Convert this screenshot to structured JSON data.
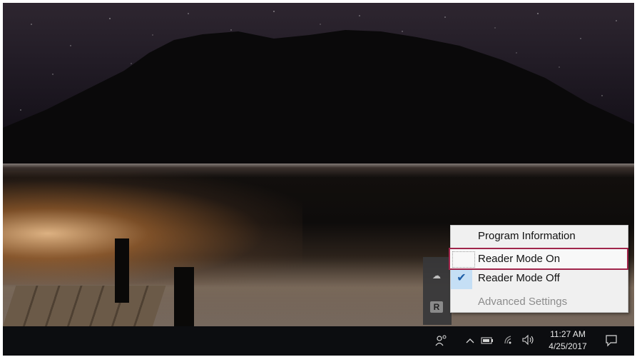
{
  "menu": {
    "items": [
      {
        "label": "Program Information",
        "checked": false,
        "disabled": false
      },
      {
        "label": "Reader Mode On",
        "checked": false,
        "disabled": false,
        "highlighted": true
      },
      {
        "label": "Reader Mode Off",
        "checked": true,
        "disabled": false
      },
      {
        "label": "Advanced Settings",
        "checked": false,
        "disabled": true
      }
    ]
  },
  "tray_overflow": {
    "icons": [
      "onedrive-cloud-icon",
      "reader-mode-r-icon"
    ],
    "reader_letter": "R"
  },
  "taskbar": {
    "time": "11:27 AM",
    "date": "4/25/2017",
    "icons": [
      "people-icon",
      "show-hidden-icons-chevron",
      "battery-icon",
      "wifi-icon",
      "volume-icon",
      "action-center-icon"
    ]
  },
  "colors": {
    "highlight_border": "#a0254b",
    "menu_bg": "#f0f0f0",
    "taskbar_bg": "#0c0d10",
    "check_bg": "#c5dff5"
  }
}
